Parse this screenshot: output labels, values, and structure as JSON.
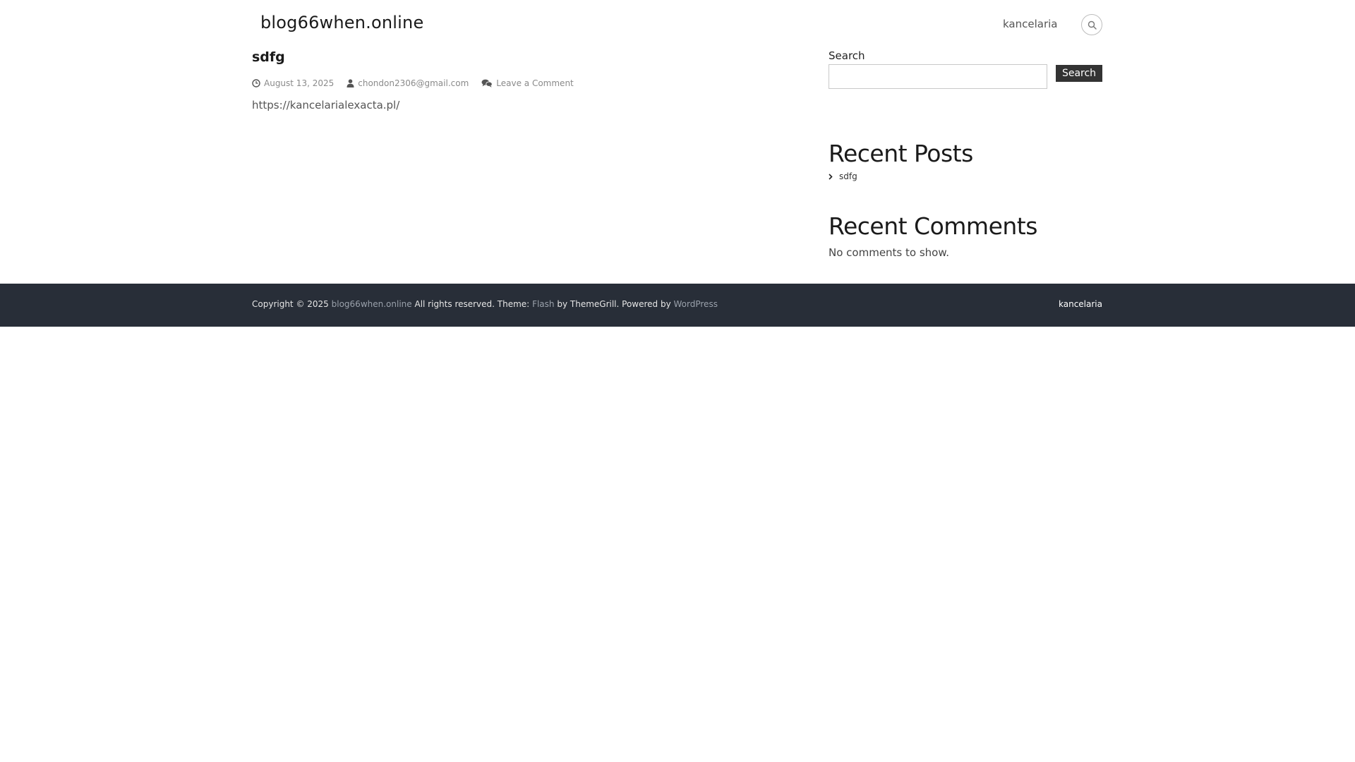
{
  "header": {
    "site_title": "blog66when.online",
    "nav_item": "kancelaria",
    "search_icon": "search-icon"
  },
  "post": {
    "title": "sdfg",
    "date": "August 13, 2025",
    "author": "chondon2306@gmail.com",
    "comment_link": "Leave a Comment",
    "content": "https://kancelarialexacta.pl/"
  },
  "sidebar": {
    "search_label": "Search",
    "search_value": "",
    "search_button": "Search",
    "recent_posts_heading": "Recent Posts",
    "recent_posts": [
      "sdfg"
    ],
    "recent_comments_heading": "Recent Comments",
    "no_comments": "No comments to show."
  },
  "footer": {
    "copyright_prefix": "Copyright © 2025",
    "site_link": "blog66when.online",
    "rights_text": "All rights reserved. Theme:",
    "theme_link": "Flash",
    "by_text": "by ThemeGrill. Powered by",
    "wordpress_link": "WordPress",
    "nav_item": "kancelaria"
  },
  "colors": {
    "footer_bg": "#282e38",
    "button_bg": "#333333",
    "muted_text": "#8a8a8a"
  }
}
